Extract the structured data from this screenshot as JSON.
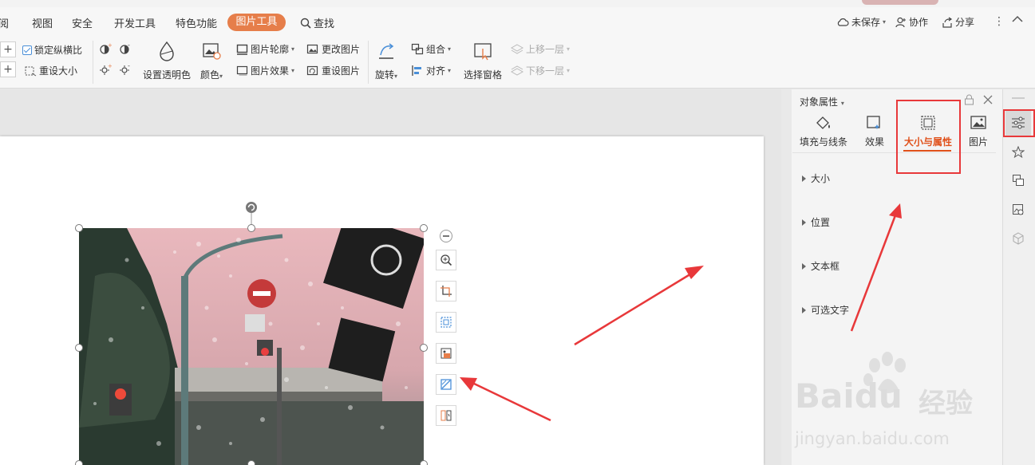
{
  "menu": {
    "items": [
      "阅",
      "视图",
      "安全",
      "开发工具",
      "特色功能"
    ],
    "active": "图片工具",
    "search": "查找",
    "unsaved": "未保存",
    "collab": "协作",
    "share": "分享"
  },
  "ribbon": {
    "lock_ratio": "锁定纵横比",
    "reset_size": "重设大小",
    "set_transparent": "设置透明色",
    "color": "颜色",
    "outline": "图片轮廓",
    "effects": "图片效果",
    "change_pic": "更改图片",
    "reset_pic": "重设图片",
    "rotate": "旋转",
    "group": "组合",
    "align": "对齐",
    "select_pane": "选择窗格",
    "bring_forward": "上移一层",
    "send_backward": "下移一层"
  },
  "panel": {
    "title": "对象属性",
    "tabs": [
      "填充与线条",
      "效果",
      "大小与属性",
      "图片"
    ],
    "active_tab": "大小与属性",
    "sections": [
      "大小",
      "位置",
      "文本框",
      "可选文字"
    ]
  },
  "colors": {
    "accent": "#e67e4a",
    "active_tab": "#e0501a",
    "annotation": "#e8383a"
  },
  "watermark": {
    "brand": "Baidu",
    "brand_cn": "经验",
    "url": "jingyan.baidu.com"
  }
}
